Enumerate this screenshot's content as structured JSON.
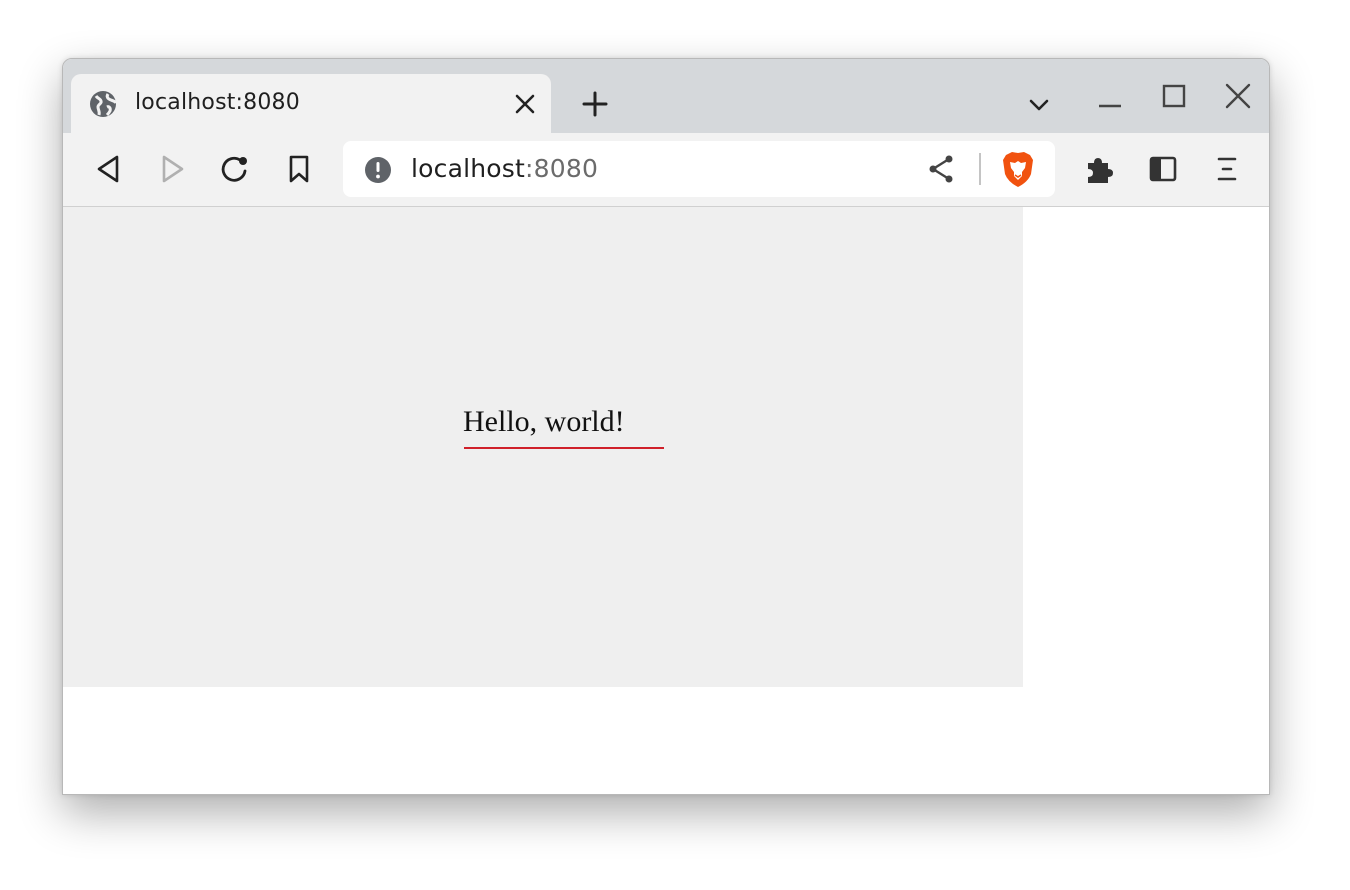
{
  "tab": {
    "title": "localhost:8080",
    "favicon": "globe-icon"
  },
  "tabstrip": {
    "new_tab_icon": "plus-icon",
    "tab_search_icon": "chevron-down-icon"
  },
  "window_controls": {
    "minimize_icon": "minimize-icon",
    "maximize_icon": "maximize-icon",
    "close_icon": "close-icon"
  },
  "toolbar": {
    "back_icon": "back-icon",
    "forward_icon": "forward-icon",
    "reload_icon": "reload-icon",
    "bookmark_icon": "bookmark-icon",
    "extensions_icon": "puzzle-icon",
    "sidebar_icon": "sidebar-icon",
    "menu_icon": "menu-icon"
  },
  "omnibox": {
    "host": "localhost",
    "port": ":8080",
    "security_icon": "info-icon",
    "share_icon": "share-icon",
    "shields_icon": "brave-lion-icon"
  },
  "page": {
    "text": "Hello, world!"
  },
  "colors": {
    "tabstrip_bg": "#d5d8db",
    "toolbar_bg": "#f2f2f2",
    "page_box_bg": "#efefef",
    "underline": "#d0202a",
    "brave_orange": "#f1520f",
    "icon_dark": "#333333",
    "icon_disabled": "#b0b0b0"
  }
}
